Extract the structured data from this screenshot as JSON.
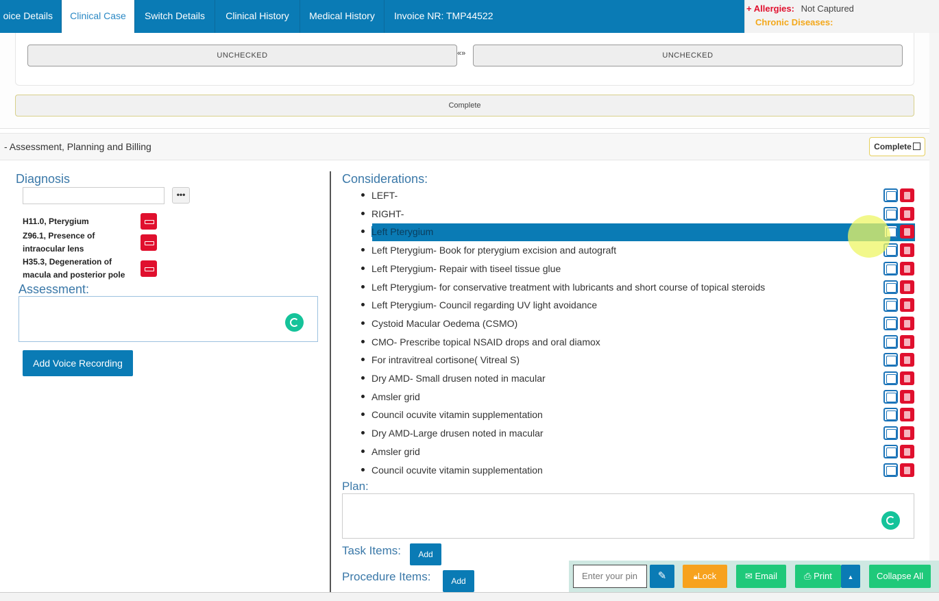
{
  "tabs": [
    {
      "label": "oice Details"
    },
    {
      "label": "Clinical Case"
    },
    {
      "label": "Switch Details"
    },
    {
      "label": "Clinical History"
    },
    {
      "label": "Medical History"
    },
    {
      "label": "Invoice NR: TMP44522"
    }
  ],
  "alerts": {
    "allergies_label": "+ Allergies:",
    "allergies_value": "Not Captured",
    "chronic_label": "Chronic Diseases:"
  },
  "upper": {
    "left_status": "UNCHECKED",
    "swap_symbol": "«»",
    "right_status": "UNCHECKED",
    "complete_label": "Complete"
  },
  "section": {
    "title": "- Assessment, Planning and Billing",
    "complete_label": "Complete"
  },
  "diagnosis": {
    "heading": "Diagnosis",
    "input_value": "",
    "more_label": "•••",
    "items": [
      {
        "line1": "H11.0, Pterygium",
        "line2": ""
      },
      {
        "line1": "Z96.1, Presence of",
        "line2": "intraocular lens"
      },
      {
        "line1": "H35.3, Degeneration of",
        "line2": "macula and posterior pole"
      }
    ]
  },
  "assessment": {
    "heading": "Assessment:",
    "value": "",
    "voice_button": "Add Voice Recording"
  },
  "considerations": {
    "heading": "Considerations:",
    "selected_index": 2,
    "items": [
      "LEFT-",
      "RIGHT-",
      "Left Pterygium",
      "Left Pterygium- Book for pterygium excision and autograft",
      "Left Pterygium- Repair with tiseel tissue glue",
      "Left Pterygium- for conservative treatment with lubricants and short course of topical steroids",
      "Left Pterygium- Council regarding UV light avoidance",
      "Cystoid Macular Oedema (CSMO)",
      "CMO- Prescribe topical NSAID drops and oral diamox",
      "For intravitreal cortisone( Vitreal S)",
      "Dry AMD- Small drusen noted in macular",
      "Amsler grid",
      "Council ocuvite vitamin supplementation",
      "Dry AMD-Large drusen noted in macular",
      "Amsler grid",
      "Council ocuvite vitamin supplementation"
    ]
  },
  "plan": {
    "heading": "Plan:",
    "value": ""
  },
  "task_items": {
    "label": "Task Items:",
    "add": "Add"
  },
  "procedure_items": {
    "label": "Procedure Items:",
    "add": "Add"
  },
  "toolbar": {
    "pin_placeholder": "Enter your pin",
    "lock": "Lock",
    "email": "Email",
    "print": "Print",
    "collapse_all": "Collapse All"
  },
  "colors": {
    "primary": "#0a7bb5",
    "danger": "#e0102e",
    "success": "#1fc97a",
    "warning": "#f7a21d"
  }
}
